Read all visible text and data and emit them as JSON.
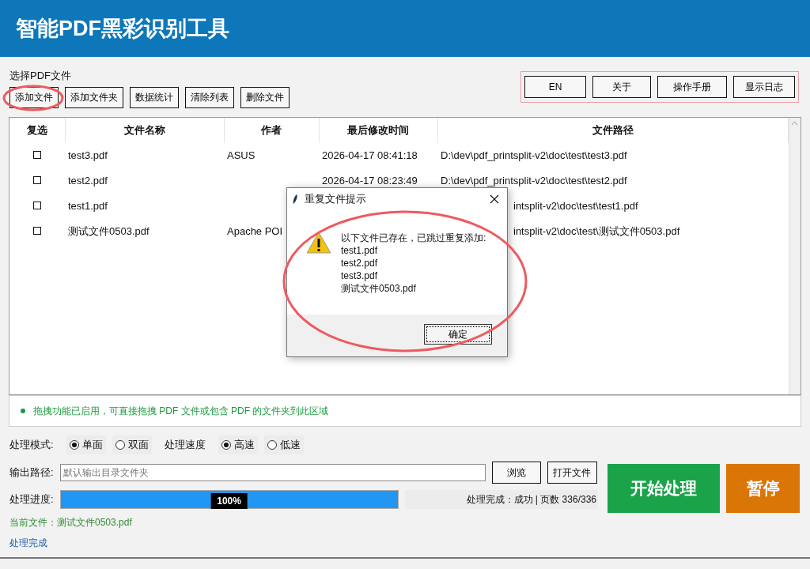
{
  "app_title": "智能PDF黑彩识别工具",
  "file_section_label": "选择PDF文件",
  "toolbar": [
    {
      "label": "添加文件",
      "highlighted": true
    },
    {
      "label": "添加文件夹",
      "highlighted": false
    },
    {
      "label": "数据统计",
      "highlighted": false
    },
    {
      "label": "清除列表",
      "highlighted": false
    },
    {
      "label": "删除文件",
      "highlighted": false
    }
  ],
  "top_right_buttons": [
    "EN",
    "关于",
    "操作手册",
    "显示日志"
  ],
  "table": {
    "columns": [
      "复选",
      "文件名称",
      "作者",
      "最后修改时间",
      "文件路径"
    ],
    "rows": [
      {
        "checked": false,
        "name": "test3.pdf",
        "author": "ASUS",
        "modified": "2026-04-17 08:41:18",
        "path": "D:\\dev\\pdf_printsplit-v2\\doc\\test\\test3.pdf"
      },
      {
        "checked": false,
        "name": "test2.pdf",
        "modified": "2026-04-17 08:23:49",
        "path": "D:\\dev\\pdf_printsplit-v2\\doc\\test\\test2.pdf"
      },
      {
        "checked": false,
        "name": "test1.pdf",
        "path": "intsplit-v2\\doc\\test\\test1.pdf"
      },
      {
        "checked": false,
        "name": "测试文件0503.pdf",
        "author": "Apache POI",
        "path": "intsplit-v2\\doc\\test\\测试文件0503.pdf"
      }
    ]
  },
  "drop_hint": "拖拽功能已启用，可直接拖拽 PDF 文件或包含 PDF 的文件夹到此区域",
  "options": [
    {
      "label": "处理模式:",
      "choices": [
        {
          "label": "单面",
          "selected": true
        },
        {
          "label": "双面",
          "selected": false
        }
      ]
    },
    {
      "label": "处理速度",
      "choices": [
        {
          "label": "高速",
          "selected": true
        },
        {
          "label": "低速",
          "selected": false
        }
      ]
    }
  ],
  "output": {
    "label": "输出路径:",
    "placeholder": "默认输出目录文件夹",
    "buttons": [
      "浏览",
      "打开文件"
    ]
  },
  "progress": {
    "label": "处理进度:",
    "level": 1,
    "text": "100%",
    "status": "处理完成：成功 | 页数 336/336"
  },
  "start_button": "开始处理",
  "pause_button": "暂停",
  "current_file": "当前文件：测试文件0503.pdf",
  "status_message": "处理完成",
  "dialog": {
    "title": "重复文件提示",
    "message": "以下文件已存在，已跳过重复添加:",
    "files": [
      "test1.pdf",
      "test2.pdf",
      "test3.pdf",
      "测试文件0503.pdf"
    ],
    "button": "确定",
    "highlighted": true
  }
}
